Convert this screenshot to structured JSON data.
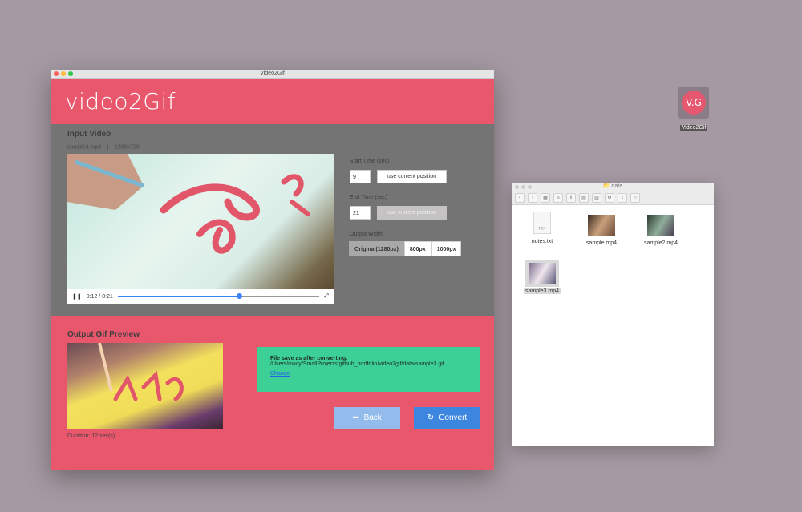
{
  "desktop": {
    "icon_text": "V.G",
    "icon_label": "Video2Gif"
  },
  "window": {
    "title": "Video2Gif",
    "app_name": "video2Gif"
  },
  "input": {
    "section_title": "Input Video",
    "file_name": "sample3.mp4",
    "resolution": "1280x720",
    "time_display": "0:12 / 0:21",
    "progress": 0.6,
    "start_label": "Start Time (sec)",
    "start_value": "9",
    "end_label": "End Time (sec)",
    "end_value": "21",
    "use_current_position": "use current position",
    "output_width_label": "Output Width",
    "width_options": [
      "Original(1280px)",
      "800px",
      "1000px"
    ],
    "selected_width": "Original(1280px)"
  },
  "output": {
    "section_title": "Output Gif Preview",
    "duration": "Duration: 12 sec(s)",
    "save_heading": "File save as after converting:",
    "save_path": "/Users/macy/SmallProjects/github_portfolio/video2gif/data/sample3.gif",
    "change_link": "Change",
    "back_label": "Back",
    "convert_label": "Convert"
  },
  "finder": {
    "title": "data",
    "files": [
      {
        "name": "notes.txt",
        "kind": "txt",
        "badge": "TXT"
      },
      {
        "name": "sample.mp4",
        "kind": "video"
      },
      {
        "name": "sample2.mp4",
        "kind": "video"
      },
      {
        "name": "sample3.mp4",
        "kind": "video",
        "selected": true
      }
    ]
  },
  "colors": {
    "brand": "#e9576d",
    "body_gray": "#757474",
    "save_box": "#3ccf96",
    "primary_button": "#3d86e0",
    "secondary_button": "#93bcec",
    "progress": "#3b82f6"
  }
}
